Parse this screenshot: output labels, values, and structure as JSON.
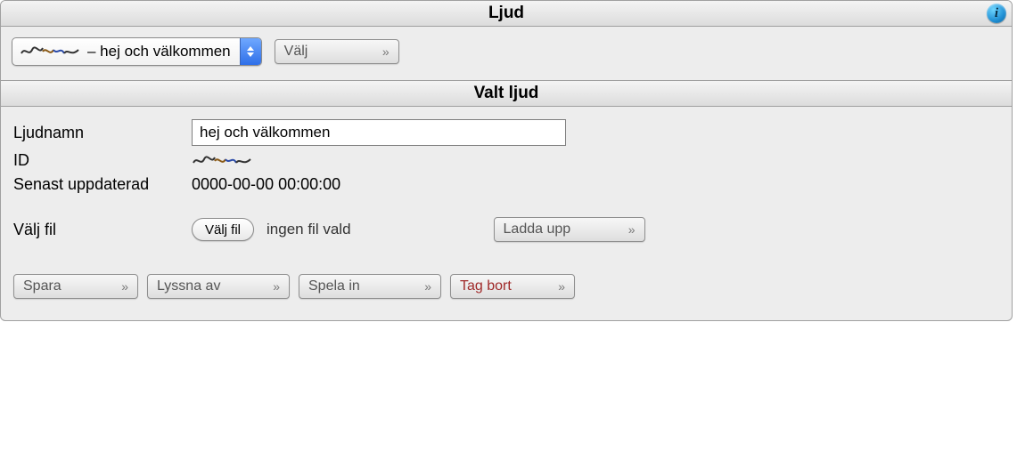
{
  "header": {
    "title": "Ljud"
  },
  "top": {
    "combo_label": "– hej och välkommen",
    "select_label": "Välj"
  },
  "section": {
    "title": "Valt ljud"
  },
  "form": {
    "name_label": "Ljudnamn",
    "name_value": "hej och välkommen",
    "id_label": "ID",
    "updated_label": "Senast uppdaterad",
    "updated_value": "0000-00-00 00:00:00",
    "choose_file_label": "Välj fil",
    "choose_file_button": "Välj fil",
    "no_file_text": "ingen fil vald",
    "upload_label": "Ladda upp"
  },
  "actions": {
    "save": "Spara",
    "listen": "Lyssna av",
    "record": "Spela in",
    "delete": "Tag bort"
  },
  "glyphs": {
    "chev": "»",
    "info": "i"
  }
}
